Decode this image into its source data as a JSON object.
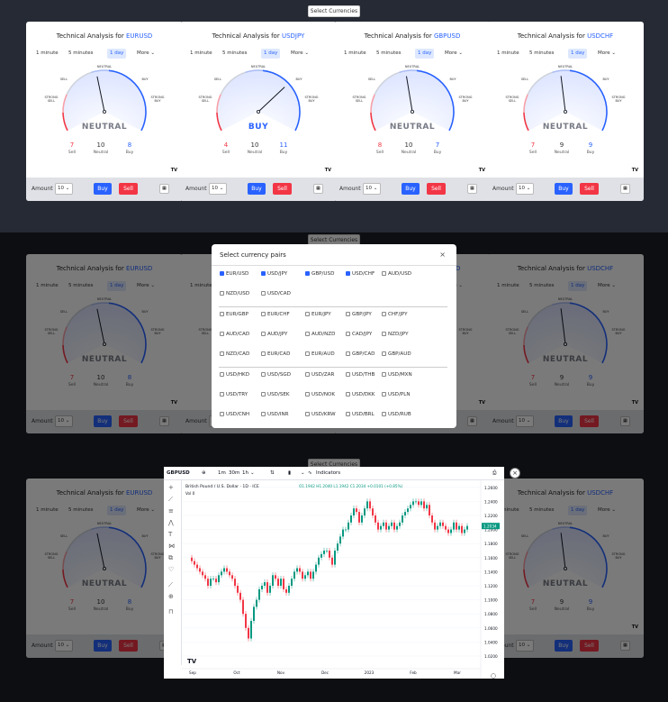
{
  "top_button": "Select Currencies",
  "cards": [
    {
      "title": "Technical Analysis for ",
      "pair": "EURUSD",
      "timeframes": [
        "1 minute",
        "5 minutes",
        "1 day",
        "More"
      ],
      "active_tf": 2,
      "verdict": "NEUTRAL",
      "sell": "7",
      "neutral": "10",
      "buy": "8",
      "sell_label": "Sell",
      "neutral_label": "Neutral",
      "buy_label": "Buy",
      "needle": 0.45
    },
    {
      "title": "Technical Analysis for ",
      "pair": "USDJPY",
      "timeframes": [
        "1 minute",
        "5 minutes",
        "1 day",
        "More"
      ],
      "active_tf": 2,
      "verdict": "BUY",
      "sell": "4",
      "neutral": "10",
      "buy": "11",
      "sell_label": "Sell",
      "neutral_label": "Neutral",
      "buy_label": "Buy",
      "needle": 0.7
    },
    {
      "title": "Technical Analysis for ",
      "pair": "GBPUSD",
      "timeframes": [
        "1 minute",
        "5 minutes",
        "1 day",
        "More"
      ],
      "active_tf": 2,
      "verdict": "NEUTRAL",
      "sell": "8",
      "neutral": "10",
      "buy": "7",
      "sell_label": "Sell",
      "neutral_label": "Neutral",
      "buy_label": "Buy",
      "needle": 0.46
    },
    {
      "title": "Technical Analysis for ",
      "pair": "USDCHF",
      "timeframes": [
        "1 minute",
        "5 minutes",
        "1 day",
        "More"
      ],
      "active_tf": 2,
      "verdict": "NEUTRAL",
      "sell": "7",
      "neutral": "9",
      "buy": "9",
      "sell_label": "Sell",
      "neutral_label": "Neutral",
      "buy_label": "Buy",
      "needle": 0.47
    }
  ],
  "gauge_labels": {
    "neutral": "NEUTRAL",
    "sell": "SELL",
    "buy": "BUY",
    "strong_sell_1": "STRONG",
    "strong_sell_2": "SELL",
    "strong_buy_1": "STRONG",
    "strong_buy_2": "BUY"
  },
  "footer": {
    "amount_label": "Amount",
    "amount_value": "10",
    "buy": "Buy",
    "sell": "Sell"
  },
  "tv_mark": "TV",
  "modal": {
    "title": "Select currency pairs",
    "close": "×",
    "groups": [
      [
        {
          "label": "EUR/USD",
          "on": true
        },
        {
          "label": "USD/JPY",
          "on": true
        },
        {
          "label": "GBP/USD",
          "on": true
        },
        {
          "label": "USD/CHF",
          "on": true
        },
        {
          "label": "AUD/USD",
          "on": false
        },
        {
          "label": "NZD/USD",
          "on": false
        },
        {
          "label": "USD/CAD",
          "on": false
        }
      ],
      [
        {
          "label": "EUR/GBP",
          "on": false
        },
        {
          "label": "EUR/CHF",
          "on": false
        },
        {
          "label": "EUR/JPY",
          "on": false
        },
        {
          "label": "GBP/JPY",
          "on": false
        },
        {
          "label": "CHF/JPY",
          "on": false
        },
        {
          "label": "AUD/CAD",
          "on": false
        },
        {
          "label": "AUD/JPY",
          "on": false
        },
        {
          "label": "AUD/NZD",
          "on": false
        },
        {
          "label": "CAD/JPY",
          "on": false
        },
        {
          "label": "NZD/JPY",
          "on": false
        },
        {
          "label": "NZD/CAD",
          "on": false
        },
        {
          "label": "EUR/CAD",
          "on": false
        },
        {
          "label": "EUR/AUD",
          "on": false
        },
        {
          "label": "GBP/CAD",
          "on": false
        },
        {
          "label": "GBP/AUD",
          "on": false
        }
      ],
      [
        {
          "label": "USD/HKD",
          "on": false
        },
        {
          "label": "USD/SGD",
          "on": false
        },
        {
          "label": "USD/ZAR",
          "on": false
        },
        {
          "label": "USD/THB",
          "on": false
        },
        {
          "label": "USD/MXN",
          "on": false
        },
        {
          "label": "USD/TRY",
          "on": false
        },
        {
          "label": "USD/SEK",
          "on": false
        },
        {
          "label": "USD/NOK",
          "on": false
        },
        {
          "label": "USD/DKK",
          "on": false
        },
        {
          "label": "USD/PLN",
          "on": false
        },
        {
          "label": "USD/CNH",
          "on": false
        },
        {
          "label": "USD/INR",
          "on": false
        },
        {
          "label": "USD/KRW",
          "on": false
        },
        {
          "label": "USD/BRL",
          "on": false
        },
        {
          "label": "USD/RUB",
          "on": false
        }
      ]
    ]
  },
  "chart_popup": {
    "symbol": "GBPUSD",
    "intervals": [
      "1m",
      "30m",
      "1h"
    ],
    "indicators": "Indicators",
    "legend": "British Pound / U.S. Dollar · 1D · ICE",
    "ohlc": "O1.1942 H1.2040 L1.1942 C1.2034 +0.0101 (+0.85%)",
    "vol": "Vol  0",
    "price_tag": "1.2034",
    "close": "×"
  },
  "chart_data": {
    "type": "line",
    "title": "British Pound / U.S. Dollar · 1D · ICE",
    "x_labels": [
      "Sep",
      "Oct",
      "Nov",
      "Dec",
      "2023",
      "Feb",
      "Mar"
    ],
    "y_ticks": [
      "1.2600",
      "1.2400",
      "1.2200",
      "1.2000",
      "1.1800",
      "1.1600",
      "1.1400",
      "1.1200",
      "1.1000",
      "1.0800",
      "1.0600",
      "1.0400",
      "1.0200"
    ],
    "ylim": [
      1.02,
      1.27
    ],
    "series": [
      {
        "values": [
          1.16,
          1.155,
          1.15,
          1.145,
          1.14,
          1.135,
          1.13,
          1.12,
          1.13,
          1.13,
          1.125,
          1.135,
          1.14,
          1.145,
          1.14,
          1.135,
          1.13,
          1.12,
          1.11,
          1.1,
          1.08,
          1.06,
          1.045,
          1.07,
          1.09,
          1.1,
          1.115,
          1.12,
          1.125,
          1.11,
          1.12,
          1.135,
          1.13,
          1.12,
          1.13,
          1.115,
          1.11,
          1.12,
          1.13,
          1.14,
          1.145,
          1.14,
          1.13,
          1.135,
          1.14,
          1.13,
          1.14,
          1.15,
          1.16,
          1.165,
          1.17,
          1.17,
          1.16,
          1.15,
          1.17,
          1.18,
          1.19,
          1.2,
          1.2,
          1.21,
          1.22,
          1.23,
          1.225,
          1.21,
          1.22,
          1.23,
          1.24,
          1.23,
          1.22,
          1.21,
          1.2,
          1.205,
          1.21,
          1.2,
          1.205,
          1.21,
          1.2,
          1.205,
          1.21,
          1.22,
          1.225,
          1.23,
          1.235,
          1.24,
          1.24,
          1.235,
          1.24,
          1.23,
          1.235,
          1.22,
          1.21,
          1.2,
          1.205,
          1.21,
          1.205,
          1.2,
          1.195,
          1.2,
          1.21,
          1.2,
          1.205,
          1.195,
          1.2,
          1.205
        ]
      }
    ]
  }
}
